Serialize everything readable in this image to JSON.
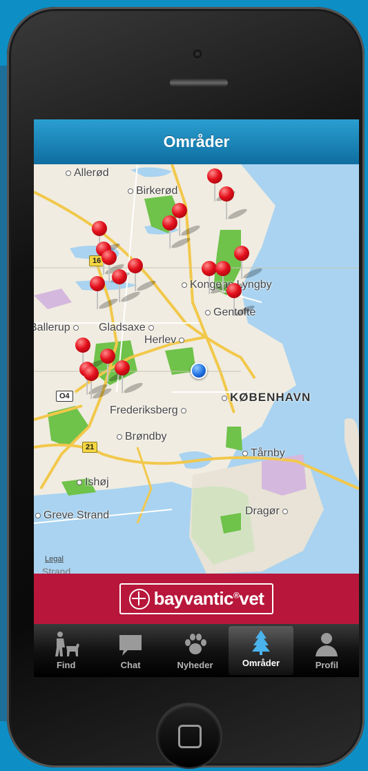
{
  "nav": {
    "title": "Områder"
  },
  "map": {
    "places": [
      {
        "name": "Allerød"
      },
      {
        "name": "Birkerød"
      },
      {
        "name": "Kongens Lyngby"
      },
      {
        "name": "Gentofte"
      },
      {
        "name": "Ballerup"
      },
      {
        "name": "Gladsaxe"
      },
      {
        "name": "Herlev"
      },
      {
        "name": "KØBENHAVN"
      },
      {
        "name": "Frederiksberg"
      },
      {
        "name": "Brøndby"
      },
      {
        "name": "Tårnby"
      },
      {
        "name": "Ishøj"
      },
      {
        "name": "Greve Strand"
      },
      {
        "name": "Dragør"
      }
    ],
    "road_shields": [
      "16",
      "O4",
      "21"
    ],
    "legal": "Legal",
    "legal_partial": "Strand"
  },
  "banner": {
    "brand": "bayvantic",
    "suffix": "vet",
    "registered": "®"
  },
  "tabs": [
    {
      "label": "Find",
      "icon": "person-with-dog-icon"
    },
    {
      "label": "Chat",
      "icon": "chat-bubble-icon"
    },
    {
      "label": "Nyheder",
      "icon": "paw-icon"
    },
    {
      "label": "Områder",
      "icon": "tree-icon"
    },
    {
      "label": "Profil",
      "icon": "person-silhouette-icon"
    }
  ],
  "colors": {
    "navbar": "#1a86bf",
    "banner": "#b8163a",
    "water": "#a9d3f0",
    "park": "#6fc24a",
    "pin": "#e3101c",
    "user_location": "#1e6fe0"
  }
}
